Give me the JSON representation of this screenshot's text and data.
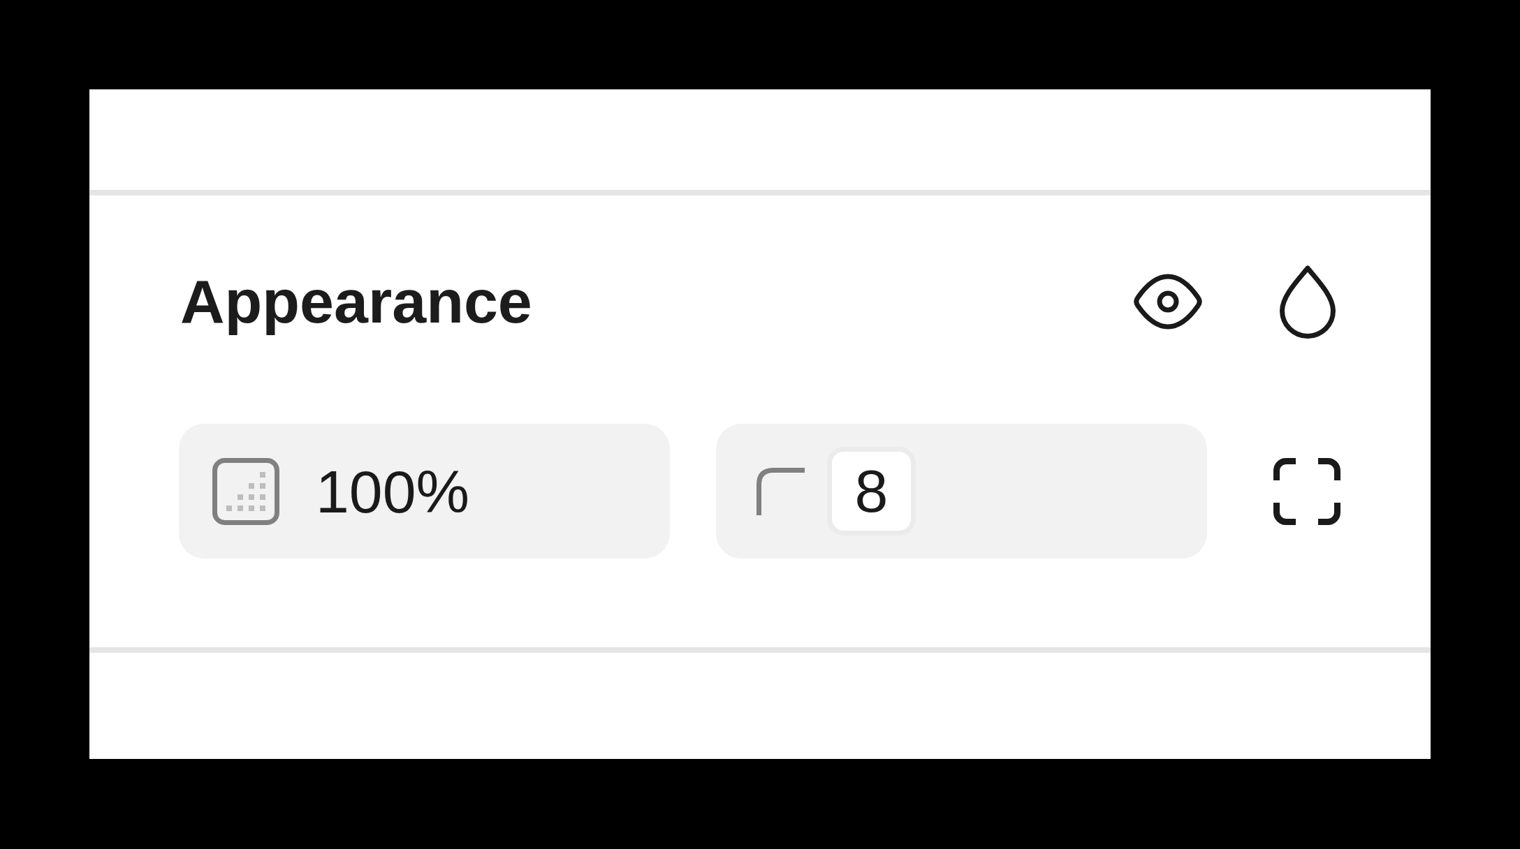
{
  "section": {
    "title": "Appearance",
    "fields": [
      {
        "kind": "opacity",
        "value": "100%"
      },
      {
        "kind": "radius",
        "value": "8"
      }
    ]
  }
}
